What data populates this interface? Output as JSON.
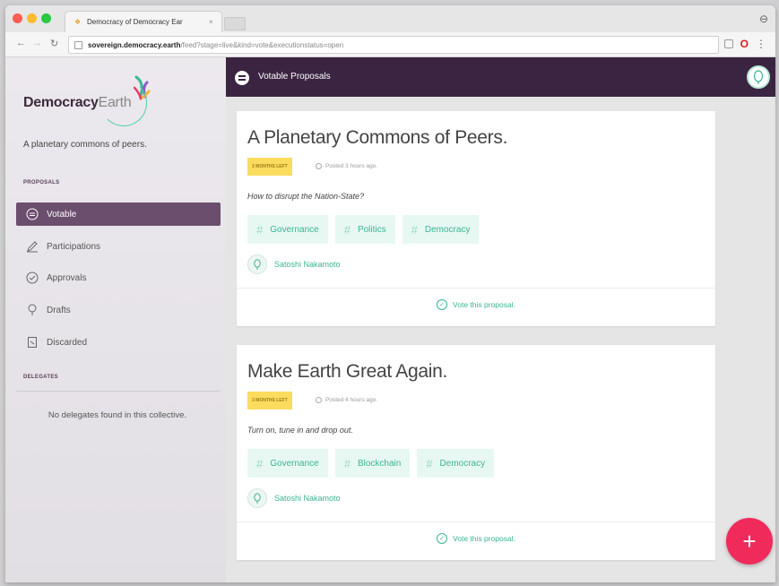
{
  "browser": {
    "tab_title": "Democracy of Democracy Ear",
    "tab_close": "×",
    "url_domain": "sovereign.democracy.earth",
    "url_path": "/feed?stage=live&kind=vote&executionstatus=open"
  },
  "app": {
    "logo_bold": "Democracy",
    "logo_light": "Earth",
    "tagline": "A planetary commons of peers.",
    "header_title": "Votable Proposals",
    "accent": "#3ab593",
    "brand": "#3b2442",
    "fab_label": "+"
  },
  "sidebar": {
    "proposals_label": "PROPOSALS",
    "items": [
      {
        "label": "Votable",
        "icon": "ballot-icon"
      },
      {
        "label": "Participations",
        "icon": "pen-icon"
      },
      {
        "label": "Approvals",
        "icon": "check-circle-icon"
      },
      {
        "label": "Drafts",
        "icon": "lightbulb-icon"
      },
      {
        "label": "Discarded",
        "icon": "trash-icon"
      }
    ],
    "delegates_label": "DELEGATES",
    "no_delegates": "No delegates found in this collective."
  },
  "proposals": [
    {
      "title": "A Planetary Commons of Peers.",
      "badge": "3 MONTHS LEFT",
      "posted": "Posted 3 hours ago.",
      "description": "How to disrupt the Nation-State?",
      "tags": [
        "Governance",
        "Politics",
        "Democracy"
      ],
      "author": "Satoshi Nakamoto",
      "vote_label": "Vote this proposal."
    },
    {
      "title": "Make Earth Great Again.",
      "badge": "3 MONTHS LEFT",
      "posted": "Posted 4 hours ago.",
      "description": "Turn on, tune in and drop out.",
      "tags": [
        "Governance",
        "Blockchain",
        "Democracy"
      ],
      "author": "Satoshi Nakamoto",
      "vote_label": "Vote this proposal."
    }
  ]
}
